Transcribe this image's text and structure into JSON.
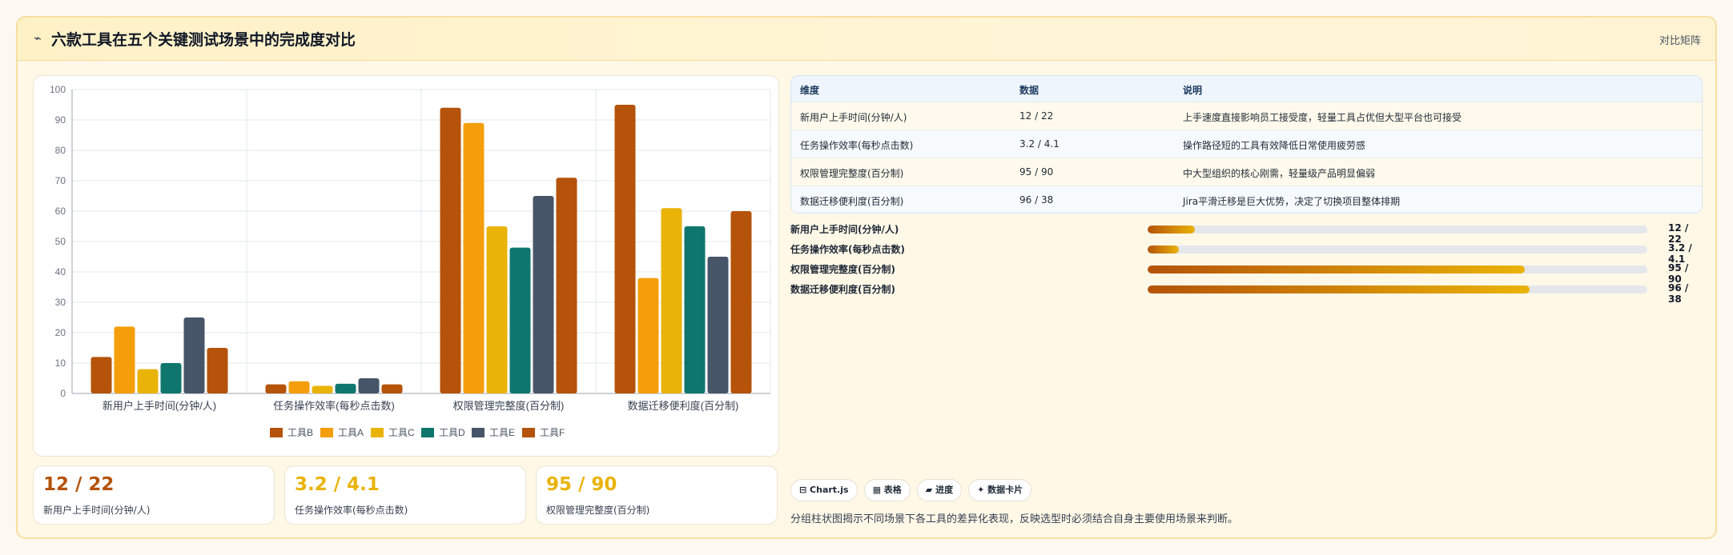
{
  "header": {
    "icon": "chart-line-icon",
    "icon_glyph": "⌁",
    "title": "六款工具在五个关键测试场景中的完成度对比",
    "right_link": "对比矩阵"
  },
  "colors": {
    "工具B": "#b45309",
    "工具A": "#f59e0b",
    "工具C": "#eab308",
    "工具D": "#0f766e",
    "工具E": "#475569",
    "工具F": "#b45309"
  },
  "chart_data": {
    "type": "bar",
    "categories": [
      "新用户上手时间(分钟/人)",
      "任务操作效率(每秒点击数)",
      "权限管理完整度(百分制)",
      "数据迁移便利度(百分制)"
    ],
    "series": [
      {
        "name": "工具B",
        "values": [
          12,
          3,
          94,
          95
        ]
      },
      {
        "name": "工具A",
        "values": [
          22,
          4,
          89,
          38
        ]
      },
      {
        "name": "工具C",
        "values": [
          8,
          2.5,
          55,
          61
        ]
      },
      {
        "name": "工具D",
        "values": [
          10,
          3.2,
          48,
          55
        ]
      },
      {
        "name": "工具E",
        "values": [
          25,
          5,
          65,
          45
        ]
      },
      {
        "name": "工具F",
        "values": [
          15,
          3,
          71,
          60
        ]
      }
    ],
    "ylim": [
      0,
      100
    ],
    "yticks": [
      "0",
      "10",
      "20",
      "30",
      "40",
      "50",
      "60",
      "70",
      "80",
      "90",
      "100"
    ],
    "grid": true,
    "legend": "bottom"
  },
  "stats": [
    {
      "value": "12 / 22",
      "label": "新用户上手时间(分钟/人)",
      "color": "#b45309"
    },
    {
      "value": "3.2 / 4.1",
      "label": "任务操作效率(每秒点击数)",
      "color": "#eab308"
    },
    {
      "value": "95 / 90",
      "label": "权限管理完整度(百分制)",
      "color": "#eab308"
    }
  ],
  "table": {
    "headers": [
      "维度",
      "数据",
      "说明"
    ],
    "rows": [
      [
        "新用户上手时间(分钟/人)",
        "12 / 22",
        "上手速度直接影响员工接受度，轻量工具占优但大型平台也可接受"
      ],
      [
        "任务操作效率(每秒点击数)",
        "3.2 / 4.1",
        "操作路径短的工具有效降低日常使用疲劳感"
      ],
      [
        "权限管理完整度(百分制)",
        "95 / 90",
        "中大型组织的核心刚需，轻量级产品明显偏弱"
      ],
      [
        "数据迁移便利度(百分制)",
        "96 / 38",
        "Jira平滑迁移是巨大优势，决定了切换项目整体排期"
      ]
    ]
  },
  "progress": [
    {
      "label": "新用户上手时间(分钟/人)",
      "value": "12 / 22",
      "fraction": 0.095
    },
    {
      "label": "任务操作效率(每秒点击数)",
      "value": "3.2 / 4.1",
      "fraction": 0.062
    },
    {
      "label": "权限管理完整度(百分制)",
      "value": "95 / 90",
      "fraction": 0.755
    },
    {
      "label": "数据迁移便利度(百分制)",
      "value": "96 / 38",
      "fraction": 0.765
    }
  ],
  "tags": [
    {
      "label": "⊟ Chart.js",
      "icon": "chart-icon"
    },
    {
      "label": "▦ 表格",
      "icon": "table-icon"
    },
    {
      "label": "▰ 进度",
      "icon": "progress-icon"
    },
    {
      "label": "✦ 数据卡片",
      "icon": "card-icon"
    }
  ],
  "footnote": "分组柱状图揭示不同场景下各工具的差异化表现，反映选型时必须结合自身主要使用场景来判断。"
}
